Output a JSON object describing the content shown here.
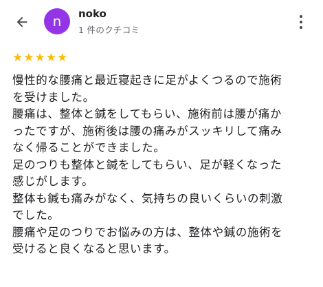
{
  "header": {
    "back_icon": "arrow-left-icon",
    "avatar_letter": "n",
    "avatar_color": "#9334e6",
    "user_name": "noko",
    "review_count": "1 件のクチコミ",
    "more_icon": "more-vert-icon"
  },
  "rating": {
    "stars": 5,
    "max": 5,
    "star_color": "#fbbc04"
  },
  "review": {
    "lines": [
      "慢性的な腰痛と最近寝起きに足がよくつるので施術",
      "を受けました。",
      "腰痛は、整体と鍼をしてもらい、施術前は腰が痛か",
      "ったですが、施術後は腰の痛みがスッキリして痛み",
      "なく帰ることができました。",
      "足のつりも整体と鍼をしてもらい、足が軽くなった",
      "感じがします。",
      "整体も鍼も痛みがなく、気持ちの良いくらいの刺激",
      "でした。",
      "腰痛や足のつりでお悩みの方は、整体や鍼の施術を",
      "受けると良くなると思います。"
    ]
  }
}
